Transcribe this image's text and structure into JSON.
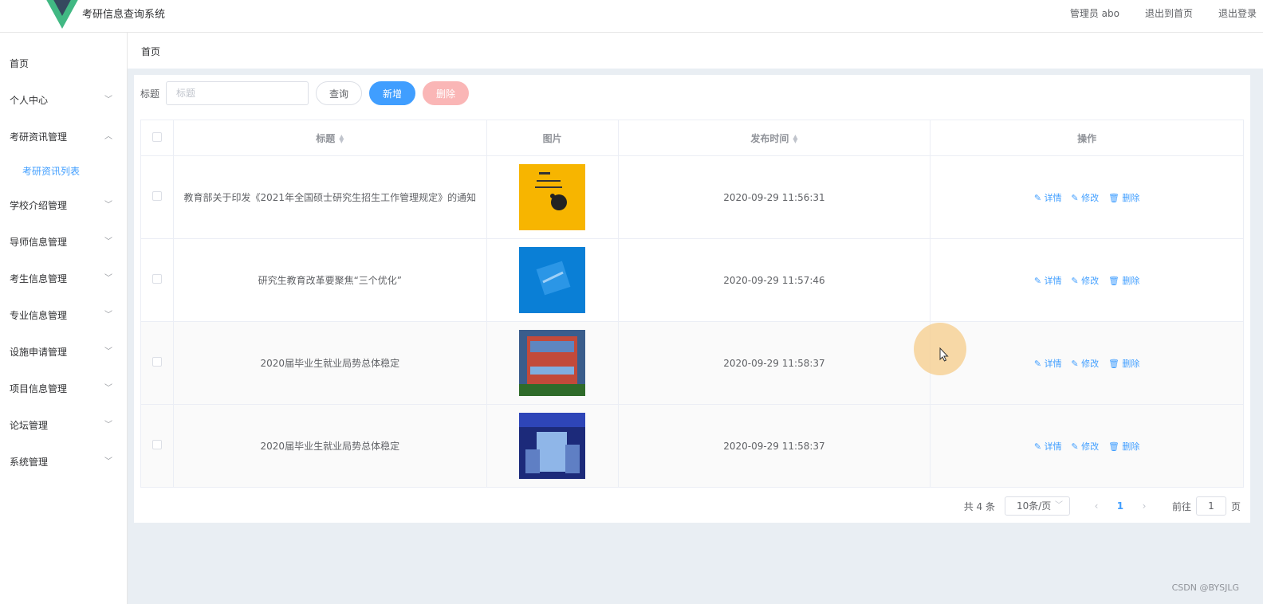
{
  "header": {
    "app_title": "考研信息查询系统",
    "admin_label": "管理员 abo",
    "back_home": "退出到首页",
    "logout": "退出登录"
  },
  "sidebar": {
    "items": [
      {
        "label": "首页"
      },
      {
        "label": "个人中心"
      },
      {
        "label": "考研资讯管理"
      },
      {
        "label": "考研资讯列表"
      },
      {
        "label": "学校介绍管理"
      },
      {
        "label": "导师信息管理"
      },
      {
        "label": "考生信息管理"
      },
      {
        "label": "专业信息管理"
      },
      {
        "label": "设施申请管理"
      },
      {
        "label": "项目信息管理"
      },
      {
        "label": "论坛管理"
      },
      {
        "label": "系统管理"
      }
    ]
  },
  "breadcrumb": "首页",
  "search": {
    "label": "标题",
    "placeholder": "标题",
    "query_button": "查询",
    "add_button": "新增",
    "delete_button": "删除"
  },
  "table": {
    "headers": {
      "title": "标题",
      "image": "图片",
      "publish_time": "发布时间",
      "actions": "操作"
    },
    "rows": [
      {
        "title": "教育部关于印发《2021年全国硕士研究生招生工作管理规定》的通知",
        "time": "2020-09-29 11:56:31"
      },
      {
        "title": "研究生教育改革要聚焦“三个优化”",
        "time": "2020-09-29 11:57:46"
      },
      {
        "title": "2020届毕业生就业局势总体稳定",
        "time": "2020-09-29 11:58:37"
      },
      {
        "title": "2020届毕业生就业局势总体稳定",
        "time": "2020-09-29 11:58:37"
      }
    ],
    "actions": {
      "detail": "详情",
      "edit": "修改",
      "delete": "删除"
    }
  },
  "pagination": {
    "total": "共 4 条",
    "page_size": "10条/页",
    "current_page": "1",
    "goto_prefix": "前往",
    "goto_value": "1",
    "goto_suffix": "页"
  },
  "watermark": "CSDN @BYSJLG",
  "colors": {
    "accent": "#409eff",
    "danger_disabled": "#fab6b6"
  }
}
